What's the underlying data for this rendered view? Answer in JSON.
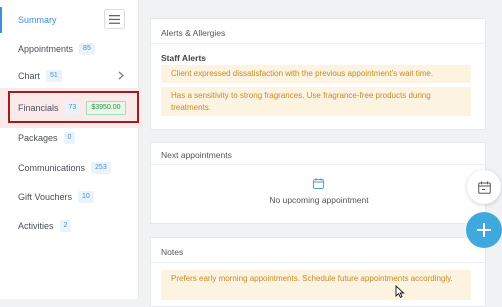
{
  "sidebar": {
    "items": [
      {
        "label": "Summary"
      },
      {
        "label": "Appointments",
        "count": "85"
      },
      {
        "label": "Chart",
        "count": "51"
      },
      {
        "label": "Financials",
        "count": "73",
        "amount": "$3950.00"
      },
      {
        "label": "Packages",
        "count": "0"
      },
      {
        "label": "Communications",
        "count": "253"
      },
      {
        "label": "Gift Vouchers",
        "count": "10"
      },
      {
        "label": "Activities",
        "count": "2"
      }
    ]
  },
  "alerts_card": {
    "title": "Alerts & Allergies",
    "subtitle": "Staff Alerts",
    "alerts": [
      "Client expressed dissatisfaction with the previous appointment's wait time.",
      "Has a sensitivity to strong fragrances. Use fragrance-free products during treatments."
    ]
  },
  "appointments_card": {
    "title": "Next appointments",
    "empty_text": "No upcoming appointment"
  },
  "notes_card": {
    "title": "Notes",
    "note": "Prefers early morning appointments. Schedule future appointments accordingly."
  },
  "colors": {
    "accent": "#3f8fd6",
    "fab": "#3fa9de",
    "alert_bg": "#fdf3e1",
    "alert_text": "#c58b2b",
    "highlight_border": "#9b1d1d"
  }
}
